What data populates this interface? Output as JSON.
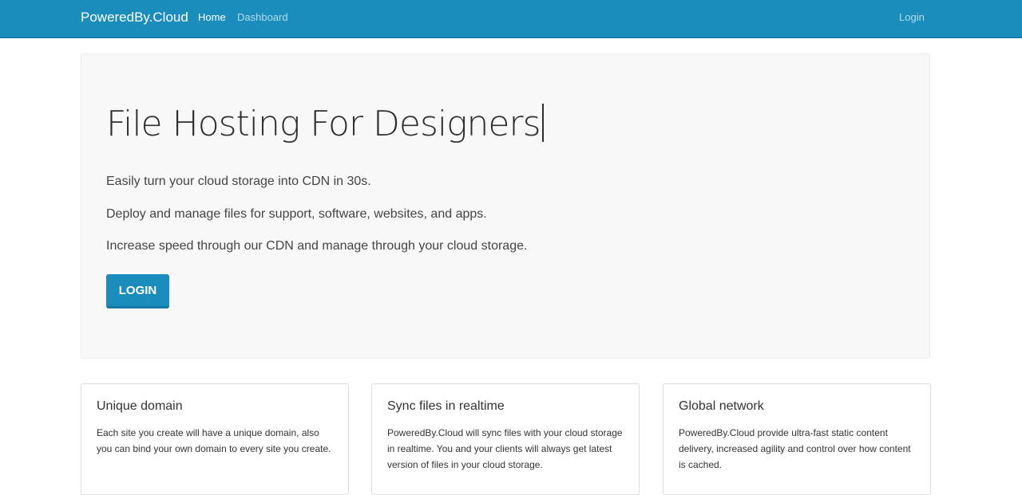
{
  "navbar": {
    "brand": "PoweredBy.Cloud",
    "links": [
      {
        "label": "Home"
      },
      {
        "label": "Dashboard"
      }
    ],
    "login": "Login"
  },
  "hero": {
    "title": "File Hosting For Designers",
    "lines": [
      "Easily turn your cloud storage into CDN in 30s.",
      "Deploy and manage files for support, software, websites, and apps.",
      "Increase speed through our CDN and manage through your cloud storage."
    ],
    "button_label": "LOGIN"
  },
  "features": [
    {
      "title": "Unique domain",
      "text": "Each site you create will have a unique domain, also you can bind your own domain to every site you create."
    },
    {
      "title": "Sync files in realtime",
      "text": "PoweredBy.Cloud will sync files with your cloud storage in realtime. You and your clients will always get latest version of files in your cloud storage."
    },
    {
      "title": "Global network",
      "text": "PoweredBy.Cloud provide ultra-fast static content delivery, increased agility and control over how content is cached."
    }
  ],
  "colors": {
    "accent": "#1a8dbd",
    "hero_background": "#f8f8f8"
  }
}
